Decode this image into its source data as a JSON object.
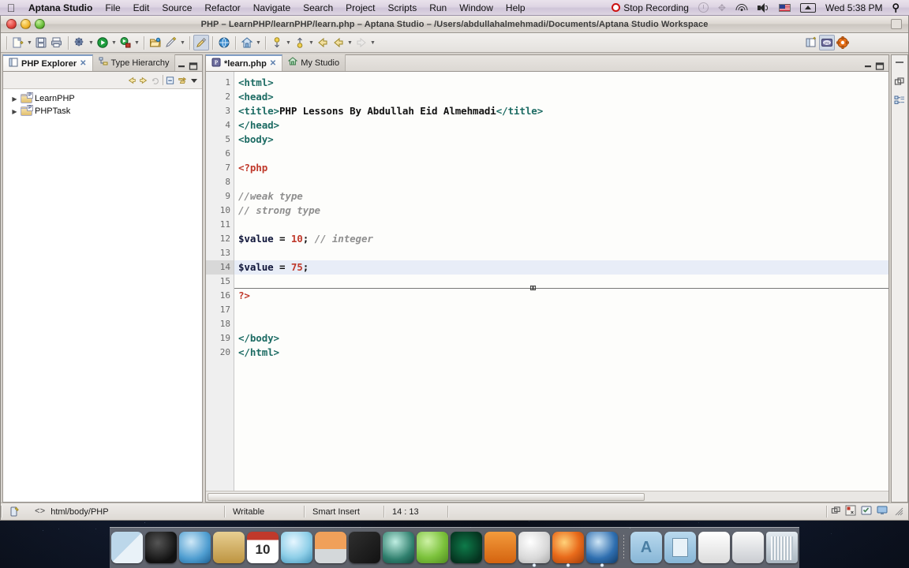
{
  "menubar": {
    "apple_icon": "apple-icon",
    "app_name": "Aptana Studio",
    "items": [
      "File",
      "Edit",
      "Source",
      "Refactor",
      "Navigate",
      "Search",
      "Project",
      "Scripts",
      "Run",
      "Window",
      "Help"
    ],
    "recording_label": "Stop Recording",
    "clock": "Wed 5:38 PM",
    "status_icons": [
      "time-machine-icon",
      "bluetooth-icon",
      "wifi-icon",
      "volume-icon",
      "us-flag-icon",
      "eject-icon"
    ],
    "search_icon": "spotlight-search-icon"
  },
  "window": {
    "title": "PHP – LearnPHP/learnPHP/learn.php – Aptana Studio – /Users/abdullahalmehmadi/Documents/Aptana Studio Workspace",
    "traffic_lights": [
      "close-button",
      "minimize-button",
      "zoom-button"
    ]
  },
  "toolbar": {
    "groups": [
      {
        "buttons": [
          {
            "name": "new-wizard-icon",
            "glyph": "new",
            "arrow": true
          },
          {
            "name": "save-icon",
            "glyph": "save",
            "arrow": false
          },
          {
            "name": "print-icon",
            "glyph": "print",
            "arrow": false
          }
        ]
      },
      {
        "buttons": [
          {
            "name": "debug-icon",
            "glyph": "debug",
            "arrow": true
          },
          {
            "name": "run-icon",
            "glyph": "run",
            "arrow": true
          },
          {
            "name": "external-tools-icon",
            "glyph": "tools",
            "arrow": true
          }
        ]
      },
      {
        "buttons": [
          {
            "name": "open-file-icon",
            "glyph": "open",
            "arrow": false
          },
          {
            "name": "edit-icon",
            "glyph": "pencil",
            "arrow": true
          }
        ]
      },
      {
        "buttons": [
          {
            "name": "preview-icon",
            "glyph": "brush",
            "arrow": false,
            "selected": true
          }
        ]
      },
      {
        "buttons": [
          {
            "name": "web-browser-icon",
            "glyph": "globe",
            "arrow": false
          }
        ]
      },
      {
        "buttons": [
          {
            "name": "home-icon",
            "glyph": "home",
            "arrow": true
          }
        ]
      },
      {
        "buttons": [
          {
            "name": "next-annotation-icon",
            "glyph": "down-arrow",
            "arrow": true
          },
          {
            "name": "prev-annotation-icon",
            "glyph": "up-arrow",
            "arrow": true
          },
          {
            "name": "back-icon",
            "glyph": "back",
            "arrow": false
          },
          {
            "name": "forward-back-icon",
            "glyph": "back2",
            "arrow": true
          },
          {
            "name": "forward-icon",
            "glyph": "fwd",
            "arrow": true
          }
        ]
      }
    ],
    "perspectives": [
      {
        "name": "open-perspective-icon",
        "label": "open-perspective"
      },
      {
        "name": "php-perspective-icon",
        "label": "PHP",
        "selected": true
      },
      {
        "name": "web-perspective-icon",
        "label": "Web"
      }
    ]
  },
  "left_panel": {
    "tabs": [
      {
        "label": "PHP Explorer",
        "active": true,
        "icon": "php-explorer-icon",
        "close": "✕"
      },
      {
        "label": "Type Hierarchy",
        "active": false,
        "icon": "type-hierarchy-icon",
        "close": ""
      }
    ],
    "view_controls": [
      "minimize-view-icon",
      "maximize-view-icon"
    ],
    "toolbar_icons": [
      "back-arrow-icon",
      "forward-arrow-icon",
      "refresh-icon",
      "collapse-all-icon",
      "link-with-editor-icon",
      "view-menu-icon"
    ],
    "tree": [
      {
        "label": "LearnPHP",
        "expanded": false,
        "icon": "php-project-folder-icon"
      },
      {
        "label": "PHPTask",
        "expanded": false,
        "icon": "php-project-folder-icon"
      }
    ]
  },
  "editor": {
    "tabs": [
      {
        "label": "*learn.php",
        "active": true,
        "icon": "php-file-icon",
        "close": "✕"
      },
      {
        "label": "My Studio",
        "active": false,
        "icon": "my-studio-icon",
        "close": ""
      }
    ],
    "view_controls": [
      "minimize-editor-icon",
      "maximize-editor-icon"
    ],
    "current_line": 14,
    "lines": [
      {
        "n": 1,
        "fold": "",
        "tokens": [
          {
            "t": "tag",
            "v": "<html>"
          }
        ]
      },
      {
        "n": 2,
        "fold": "-",
        "tokens": [
          {
            "t": "tag",
            "v": "<head>"
          }
        ]
      },
      {
        "n": 3,
        "fold": "",
        "tokens": [
          {
            "t": "tag",
            "v": "<title>"
          },
          {
            "t": "txt",
            "v": "PHP Lessons By Abdullah Eid Almehmadi"
          },
          {
            "t": "tag",
            "v": "</title>"
          }
        ]
      },
      {
        "n": 4,
        "fold": "",
        "tokens": [
          {
            "t": "tag",
            "v": "</head>"
          }
        ]
      },
      {
        "n": 5,
        "fold": "-",
        "tokens": [
          {
            "t": "tag",
            "v": "<body>"
          }
        ]
      },
      {
        "n": 6,
        "fold": "",
        "tokens": []
      },
      {
        "n": 7,
        "fold": "",
        "tokens": [
          {
            "t": "php",
            "v": "<?php"
          }
        ]
      },
      {
        "n": 8,
        "fold": "",
        "tokens": []
      },
      {
        "n": 9,
        "fold": "",
        "tokens": [
          {
            "t": "cmt",
            "v": "//weak type"
          }
        ]
      },
      {
        "n": 10,
        "fold": "",
        "tokens": [
          {
            "t": "cmt",
            "v": "// strong type"
          }
        ]
      },
      {
        "n": 11,
        "fold": "",
        "tokens": []
      },
      {
        "n": 12,
        "fold": "",
        "tokens": [
          {
            "t": "var",
            "v": "$value"
          },
          {
            "t": "op",
            "v": " = "
          },
          {
            "t": "num",
            "v": "10"
          },
          {
            "t": "op",
            "v": "; "
          },
          {
            "t": "cmt",
            "v": "// integer"
          }
        ]
      },
      {
        "n": 13,
        "fold": "",
        "tokens": []
      },
      {
        "n": 14,
        "fold": "",
        "tokens": [
          {
            "t": "var",
            "v": "$value"
          },
          {
            "t": "op",
            "v": " = "
          },
          {
            "t": "num",
            "v": "75"
          },
          {
            "t": "op",
            "v": ";"
          }
        ]
      },
      {
        "n": 15,
        "fold": "",
        "tokens": []
      },
      {
        "n": 16,
        "fold": "",
        "tokens": [
          {
            "t": "php",
            "v": "?>"
          }
        ]
      },
      {
        "n": 17,
        "fold": "",
        "tokens": []
      },
      {
        "n": 18,
        "fold": "",
        "tokens": []
      },
      {
        "n": 19,
        "fold": "",
        "tokens": [
          {
            "t": "tag",
            "v": "</body>"
          }
        ]
      },
      {
        "n": 20,
        "fold": "",
        "tokens": [
          {
            "t": "tag",
            "v": "</html>"
          }
        ]
      }
    ]
  },
  "right_strip": {
    "icons": [
      "restore-view-icon",
      "outline-view-icon"
    ]
  },
  "statusbar": {
    "left_icon": "writable-doc-icon",
    "breadcrumb_prefix": "<>",
    "breadcrumb": "html/body/PHP",
    "writable": "Writable",
    "insert_mode": "Smart Insert",
    "position": "14 : 13",
    "right_icons": [
      "restore-icon",
      "build-icon",
      "tasks-icon",
      "console-icon",
      "resize-grip-icon"
    ]
  },
  "dock": {
    "items": [
      {
        "name": "finder",
        "label": "Finder",
        "color": "#6fa8d6"
      },
      {
        "name": "dashboard",
        "label": "Dashboard",
        "color": "#1c1c1c"
      },
      {
        "name": "safari",
        "label": "Safari",
        "color": "#4e9dd0"
      },
      {
        "name": "address-book",
        "label": "Address Book",
        "color": "#c9a25a"
      },
      {
        "name": "ical",
        "label": "iCal",
        "color": "#ffffff",
        "day": "10"
      },
      {
        "name": "itunes",
        "label": "iTunes",
        "color": "#7ec8e3"
      },
      {
        "name": "iphoto",
        "label": "iPhoto",
        "color": "#d9b68a"
      },
      {
        "name": "imovie",
        "label": "iMovie",
        "color": "#2b2b2b"
      },
      {
        "name": "time-machine",
        "label": "Time Machine",
        "color": "#2f7f6d"
      },
      {
        "name": "messenger",
        "label": "Messenger",
        "color": "#8fd14f"
      },
      {
        "name": "zain",
        "label": "Zain",
        "color": "#0b4d2a"
      },
      {
        "name": "system-preferences",
        "label": "System Preferences",
        "color": "#e8721b"
      },
      {
        "name": "aptana-studio",
        "label": "Aptana Studio",
        "color": "#efefef",
        "running": true
      },
      {
        "name": "firefox",
        "label": "Firefox",
        "color": "#e96b1b",
        "running": true
      },
      {
        "name": "quicktime",
        "label": "QuickTime",
        "color": "#2f6fb0",
        "running": true
      },
      {
        "name": "separator",
        "label": ""
      },
      {
        "name": "applications-folder",
        "label": "Applications",
        "color": "#9fc3dd"
      },
      {
        "name": "documents-folder",
        "label": "Documents",
        "color": "#9fc3dd"
      },
      {
        "name": "document-stack",
        "label": "Document",
        "color": "#f2f2f2"
      },
      {
        "name": "window-stack",
        "label": "Window",
        "color": "#e8e8e8"
      },
      {
        "name": "trash",
        "label": "Trash",
        "color": "#d6dde4"
      }
    ]
  }
}
